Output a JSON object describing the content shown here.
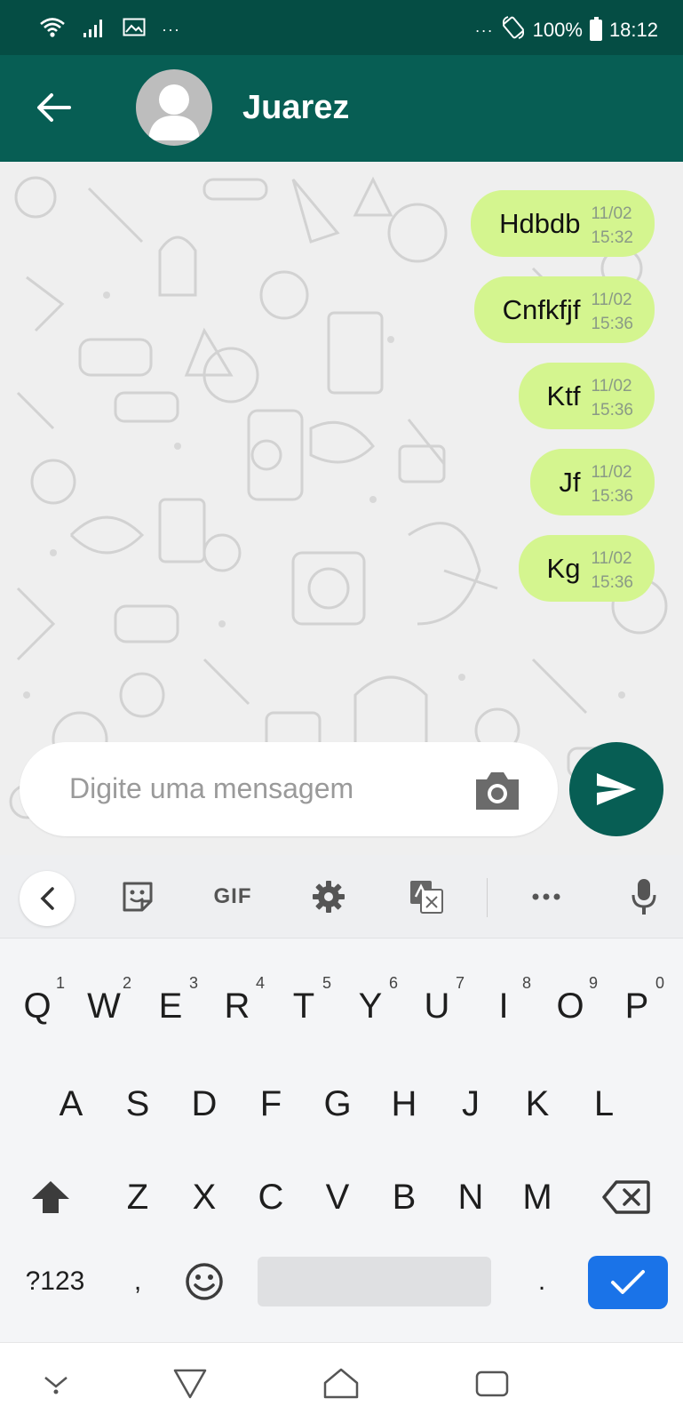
{
  "status_bar": {
    "battery": "100%",
    "time": "18:12",
    "more_left": "···",
    "more_right": "···"
  },
  "header": {
    "contact_name": "Juarez"
  },
  "messages": [
    {
      "text": "Hdbdb",
      "date": "11/02",
      "time": "15:32"
    },
    {
      "text": "Cnfkfjf",
      "date": "11/02",
      "time": "15:36"
    },
    {
      "text": "Ktf",
      "date": "11/02",
      "time": "15:36"
    },
    {
      "text": "Jf",
      "date": "11/02",
      "time": "15:36"
    },
    {
      "text": "Kg",
      "date": "11/02",
      "time": "15:36"
    }
  ],
  "input": {
    "placeholder": "Digite uma mensagem"
  },
  "keyboard": {
    "toolbar": {
      "gif_label": "GIF"
    },
    "row1": [
      {
        "key": "Q",
        "hint": "1"
      },
      {
        "key": "W",
        "hint": "2"
      },
      {
        "key": "E",
        "hint": "3"
      },
      {
        "key": "R",
        "hint": "4"
      },
      {
        "key": "T",
        "hint": "5"
      },
      {
        "key": "Y",
        "hint": "6"
      },
      {
        "key": "U",
        "hint": "7"
      },
      {
        "key": "I",
        "hint": "8"
      },
      {
        "key": "O",
        "hint": "9"
      },
      {
        "key": "P",
        "hint": "0"
      }
    ],
    "row2": [
      "A",
      "S",
      "D",
      "F",
      "G",
      "H",
      "J",
      "K",
      "L"
    ],
    "row3": [
      "Z",
      "X",
      "C",
      "V",
      "B",
      "N",
      "M"
    ],
    "symbols_label": "?123",
    "comma": ",",
    "period": "."
  },
  "colors": {
    "status_bar": "#054d44",
    "header": "#075e54",
    "bubble": "#d4f58f",
    "send_button": "#075e54",
    "enter_key": "#1a73e8"
  }
}
